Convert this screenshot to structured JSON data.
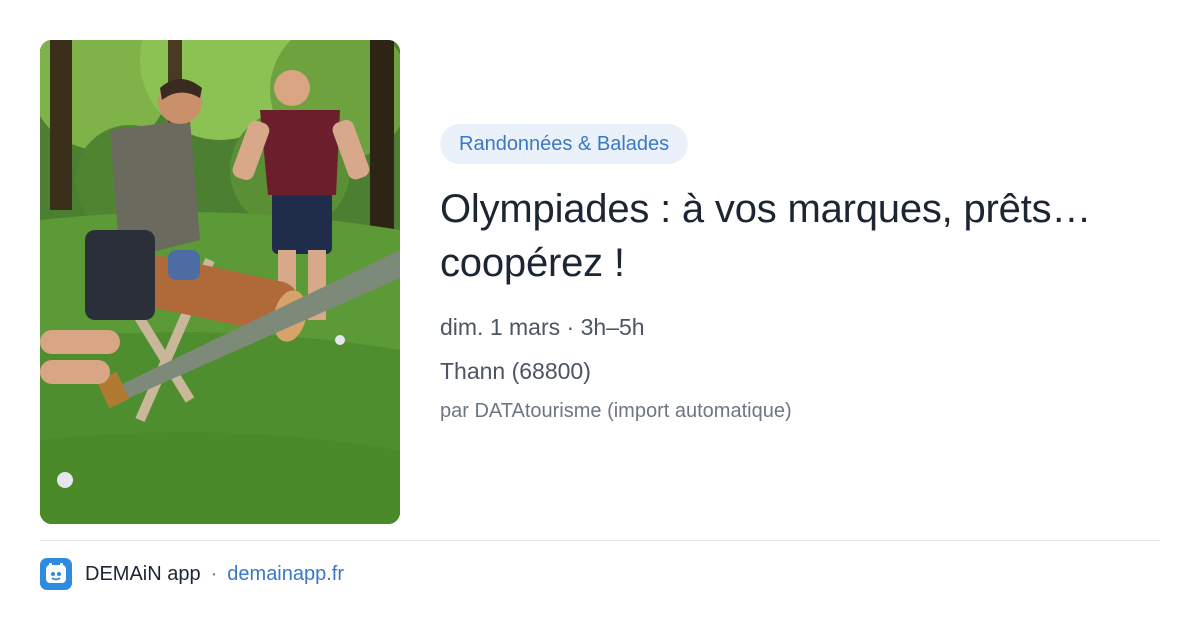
{
  "event": {
    "category": "Randonnées & Balades",
    "title": "Olympiades : à vos marques, prêts… coopérez !",
    "date": "dim. 1 mars · 3h–5h",
    "place": "Thann (68800)",
    "source": "par DATAtourisme (import automatique)",
    "image_description_icon": "photo"
  },
  "footer": {
    "app_name": "DEMAiN app",
    "separator": "·",
    "link": "demainapp.fr",
    "logo_icon": "demain-app-logo-icon"
  },
  "colors": {
    "accent": "#3b78c4",
    "pill_bg": "#eaf1fb",
    "title": "#1c2533",
    "meta": "#4b5563",
    "muted": "#6b7785",
    "logo_bg": "#2f8be0"
  }
}
